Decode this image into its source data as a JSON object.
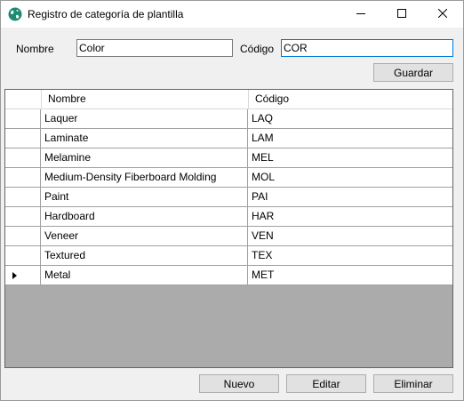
{
  "window": {
    "title": "Registro de categoría de plantilla"
  },
  "form": {
    "nombre_label": "Nombre",
    "nombre_value": "Color",
    "codigo_label": "Código",
    "codigo_value": "COR",
    "guardar_label": "Guardar"
  },
  "grid": {
    "columns": [
      "Nombre",
      "Código"
    ],
    "rows": [
      {
        "nombre": "Laquer",
        "codigo": "LAQ"
      },
      {
        "nombre": "Laminate",
        "codigo": "LAM"
      },
      {
        "nombre": "Melamine",
        "codigo": "MEL"
      },
      {
        "nombre": "Medium-Density Fiberboard Molding",
        "codigo": "MOL"
      },
      {
        "nombre": "Paint",
        "codigo": "PAI"
      },
      {
        "nombre": "Hardboard",
        "codigo": "HAR"
      },
      {
        "nombre": "Veneer",
        "codigo": "VEN"
      },
      {
        "nombre": "Textured",
        "codigo": "TEX"
      },
      {
        "nombre": "Metal",
        "codigo": "MET"
      }
    ],
    "current_row_index": 8
  },
  "actions": {
    "nuevo_label": "Nuevo",
    "editar_label": "Editar",
    "eliminar_label": "Eliminar"
  },
  "icons": {
    "app": "globe-icon",
    "minimize": "minimize-icon",
    "maximize": "maximize-icon",
    "close": "close-icon",
    "row_indicator": "current-row-arrow-icon"
  },
  "colors": {
    "focus_border": "#0078d7",
    "grid_background": "#ababab",
    "button_face": "#e1e1e1",
    "window_background": "#f0f0f0"
  }
}
